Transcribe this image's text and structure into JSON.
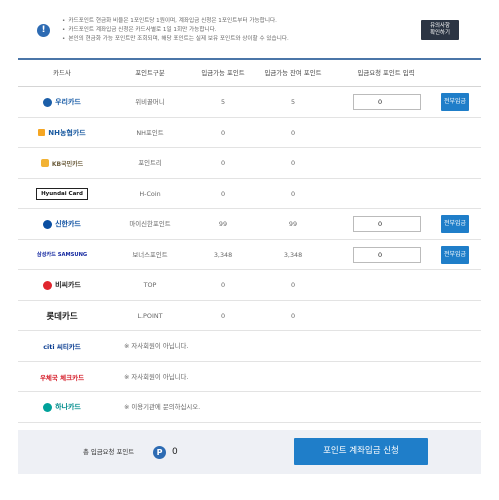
{
  "notice": {
    "lines": [
      "카드포인트 현금화 비율은 1포인트당 1원이며, 계좌입금 신청은 1포인트부터 가능합니다.",
      "카드포인트 계좌입금 신청은 카드사별로 1일 1회만 가능합니다.",
      "본인의 현금화 가능 포인트만 조회되며, 해당 포인트는 실제 보유 포인트와 상이할 수 있습니다."
    ],
    "button_line1": "유의사항",
    "button_line2": "확인하기"
  },
  "table": {
    "headers": {
      "card": "카드사",
      "point_type": "포인트구분",
      "available": "입금가능 포인트",
      "balance": "입금가능 잔여 포인트",
      "request": "입금요청 포인트 입력"
    },
    "rows": [
      {
        "card": "우리카드",
        "point": "위비꿀머니",
        "available": "5",
        "balance": "5",
        "input": "0",
        "button": "전부입금"
      },
      {
        "card": "NH농협카드",
        "point": "NH포인트",
        "available": "0",
        "balance": "0"
      },
      {
        "card": "KB국민카드",
        "point": "포인트리",
        "available": "0",
        "balance": "0"
      },
      {
        "card": "Hyundai Card",
        "point": "H-Coin",
        "available": "0",
        "balance": "0"
      },
      {
        "card": "신한카드",
        "point": "마이신한포인트",
        "available": "99",
        "balance": "99",
        "input": "0",
        "button": "전부입금"
      },
      {
        "card": "삼성카드 SAMSUNG",
        "point": "보너스포인트",
        "available": "3,348",
        "balance": "3,348",
        "input": "0",
        "button": "전부입금"
      },
      {
        "card": "비씨카드",
        "point": "TOP",
        "available": "0",
        "balance": "0"
      },
      {
        "card": "롯데카드",
        "point": "L.POINT",
        "available": "0",
        "balance": "0"
      },
      {
        "card": "citi 씨티카드",
        "note": "※ 자사회원이 아닙니다."
      },
      {
        "card": "우체국 체크카드",
        "note": "※ 자사회원이 아닙니다."
      },
      {
        "card": "하나카드",
        "note": "※ 이용기관에 문의하십시오."
      }
    ]
  },
  "footer": {
    "label": "총 입금요청 포인트",
    "p_icon": "P",
    "total": "0",
    "submit": "포인트 계좌입금 신청"
  },
  "colors": {
    "accent": "#1f7ec9",
    "header_rule": "#4b76a8",
    "footer_bg": "#eef0f5"
  }
}
